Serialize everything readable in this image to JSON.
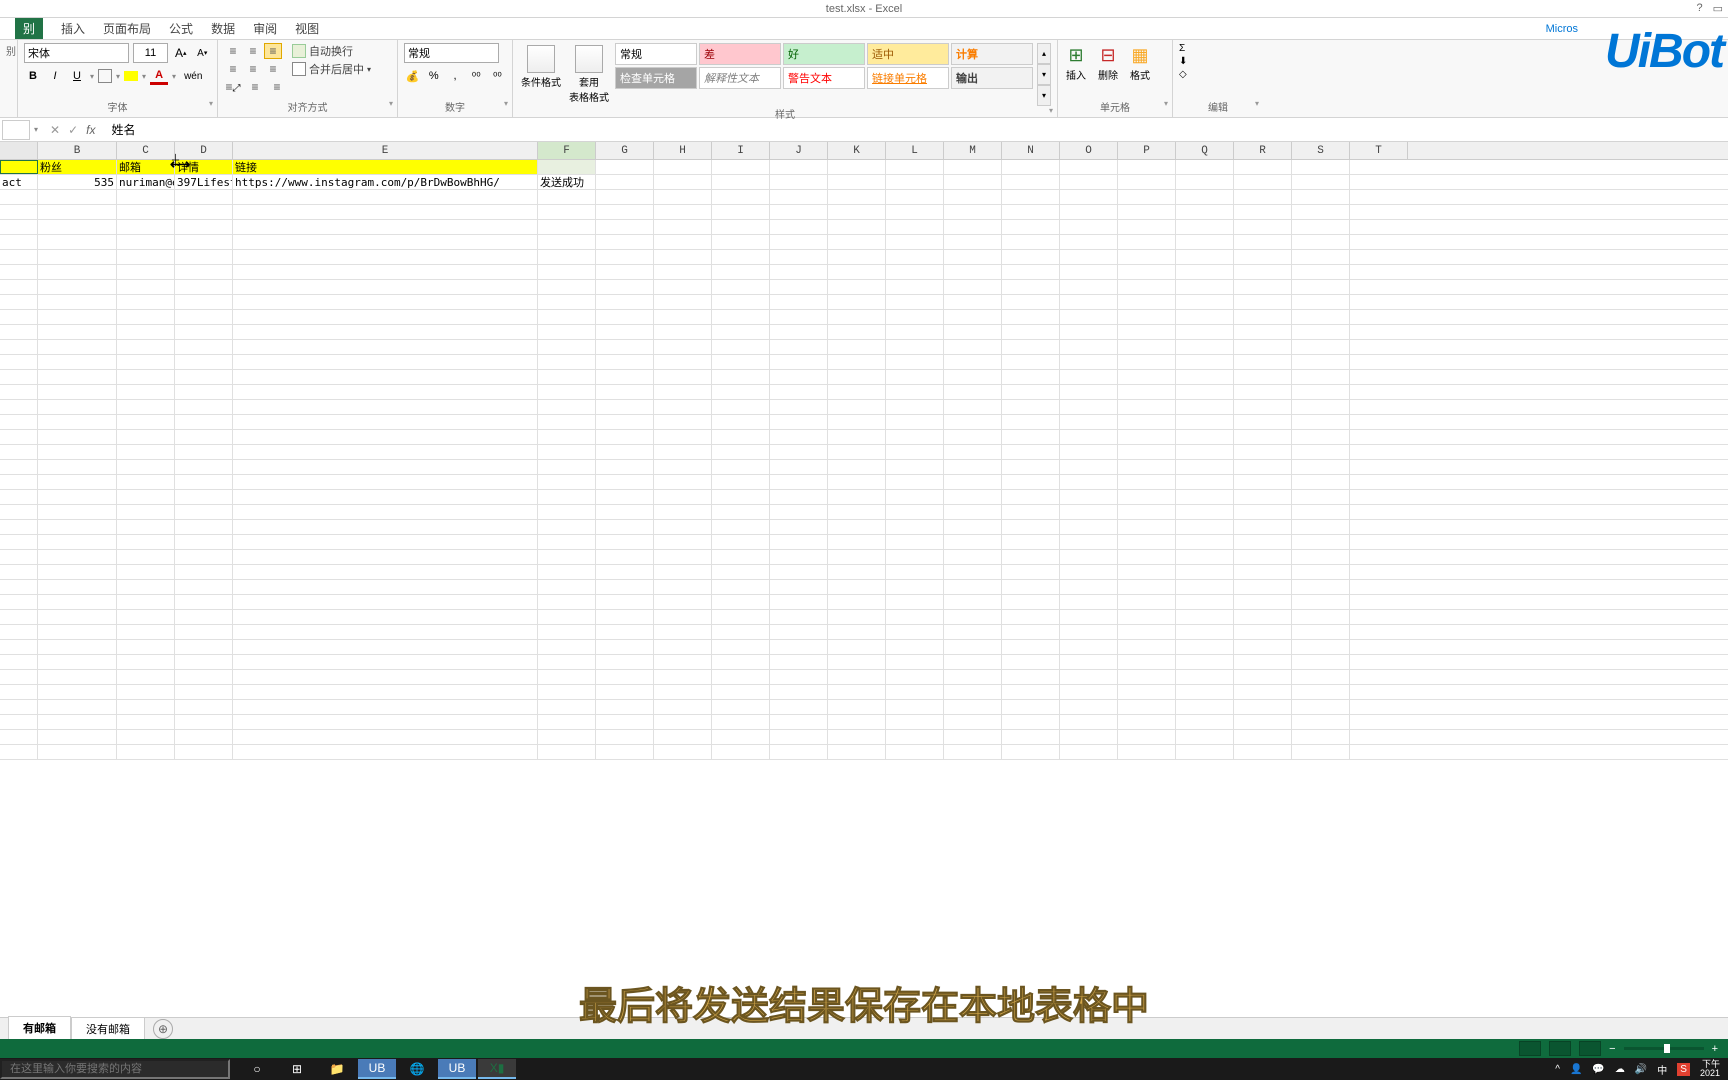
{
  "title": "test.xlsx - Excel",
  "help_icon": "?",
  "tabs": {
    "file": "别",
    "items": [
      "插入",
      "页面布局",
      "公式",
      "数据",
      "审阅",
      "视图"
    ]
  },
  "ribbon": {
    "font": {
      "name": "宋体",
      "size": "11",
      "label": "字体"
    },
    "alignment": {
      "wrap": "自动换行",
      "merge": "合并后居中",
      "label": "对齐方式"
    },
    "number": {
      "format": "常规",
      "label": "数字"
    },
    "styles": {
      "conditional": "条件格式",
      "table": "套用\n表格格式",
      "cells": {
        "normal": "常规",
        "bad": "差",
        "good": "好",
        "neutral": "适中",
        "calc": "计算",
        "check": "检查单元格",
        "explain": "解释性文本",
        "warn": "警告文本",
        "link": "链接单元格",
        "output": "输出"
      },
      "label": "样式"
    },
    "cells_group": {
      "insert": "插入",
      "delete": "删除",
      "format": "格式",
      "label": "单元格"
    },
    "editing": {
      "label": "编辑"
    }
  },
  "formula_bar": {
    "cancel": "✕",
    "enter": "✓",
    "fx": "fx",
    "content": "姓名"
  },
  "columns": [
    "B",
    "C",
    "D",
    "E",
    "F",
    "G",
    "H",
    "I",
    "J",
    "K",
    "L",
    "M",
    "N",
    "O",
    "P",
    "Q",
    "R",
    "S",
    "T"
  ],
  "column_widths": {
    "A": 38,
    "B": 79,
    "C": 58,
    "D": 58,
    "E": 305,
    "F": 58,
    "default": 58
  },
  "header_row": {
    "A": "",
    "B": "粉丝",
    "C": "邮箱",
    "D": "详情",
    "E": "链接"
  },
  "data_row": {
    "A": "act",
    "B": "535",
    "C": "nuriman@e",
    "D": "397Lifest",
    "E": "https://www.instagram.com/p/BrDwBowBhHG/",
    "F": "发送成功"
  },
  "sheets": {
    "active": "有邮箱",
    "other": "没有邮箱"
  },
  "subtitle": "最后将发送结果保存在本地表格中",
  "taskbar": {
    "search_placeholder": "在这里输入你要搜索的内容",
    "time": "下午",
    "date": "2021"
  },
  "logo": "UiBot",
  "microsoft": "Micros",
  "tray": {
    "ime": "中"
  }
}
